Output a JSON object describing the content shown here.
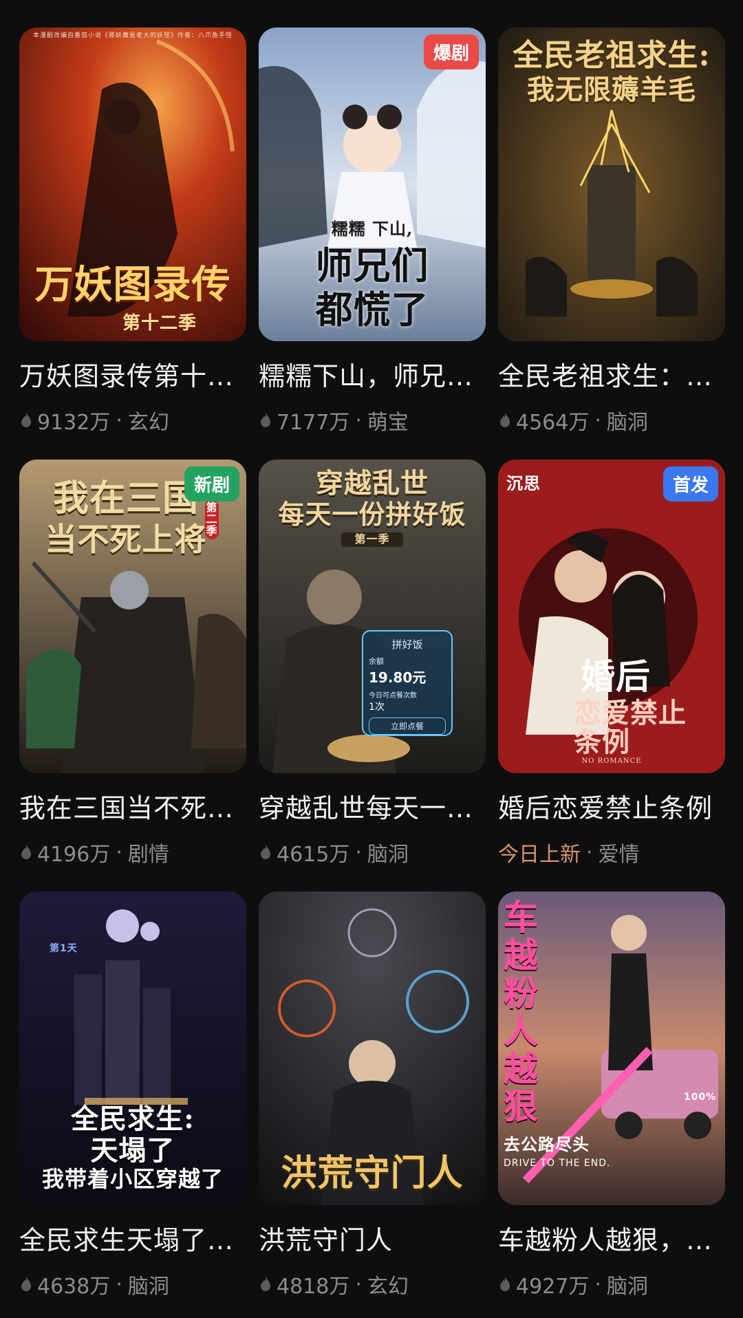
{
  "colors": {
    "background": "#0e0e0f",
    "badge_red": "#e94a47",
    "badge_green": "#23a35f",
    "badge_blue": "#3a78f0",
    "meta_gray": "#8d8d90",
    "new_today": "#d8936c"
  },
  "cards": [
    {
      "title": "万妖图录传第十…",
      "poster_title": "万妖图录传",
      "poster_sub": "第十二季",
      "poster_top_note": "本漫剧改编自番茄小说《那妖魔是老大的妖怪》作者：八爪鱼手怪",
      "badge": "",
      "views": "9132万",
      "genre": "玄幻",
      "icon": "fire-icon"
    },
    {
      "title": "糯糯下山，师兄…",
      "poster_title": "师兄们",
      "poster_sub": "都慌了",
      "poster_top_note": "糯糯 下山,",
      "badge": "爆剧",
      "views": "7177万",
      "genre": "萌宝",
      "icon": "fire-icon"
    },
    {
      "title": "全民老祖求生：…",
      "poster_title": "全民老祖求生:",
      "poster_sub": "我无限薅羊毛",
      "poster_top_note": "",
      "badge": "",
      "views": "4564万",
      "genre": "脑洞",
      "icon": "fire-icon"
    },
    {
      "title": "我在三国当不死…",
      "poster_title": "我在三国",
      "poster_sub": "当不死上将",
      "poster_top_note": "第二季",
      "badge": "新剧",
      "views": "4196万",
      "genre": "剧情",
      "icon": "fire-icon"
    },
    {
      "title": "穿越乱世每天一…",
      "poster_title": "穿越乱世",
      "poster_sub": "每天一份拼好饭",
      "poster_top_note": "第一季",
      "panel": {
        "title": "拼好饭",
        "label1": "余额",
        "amount": "19.80元",
        "label2": "今日可点餐次数",
        "count": "1次",
        "button": "立即点餐"
      },
      "badge": "",
      "views": "4615万",
      "genre": "脑洞",
      "icon": "fire-icon"
    },
    {
      "title": "婚后恋爱禁止条例",
      "poster_title": "婚后",
      "poster_sub": "恋爱禁止条例",
      "poster_top_note": "沉思",
      "poster_bottom_note": "NO ROMANCE",
      "badge": "首发",
      "views": "",
      "status_text": "今日上新",
      "genre": "爱情",
      "icon": ""
    },
    {
      "title": "全民求生天塌了…",
      "poster_title": "全民求生:",
      "poster_sub": "天塌了",
      "poster_sub2": "我带着小区穿越了",
      "poster_top_note": "第1天",
      "badge": "",
      "views": "4638万",
      "genre": "脑洞",
      "icon": "fire-icon"
    },
    {
      "title": "洪荒守门人",
      "poster_title": "洪荒守门人",
      "poster_sub": "",
      "poster_top_note": "",
      "badge": "",
      "views": "4818万",
      "genre": "玄幻",
      "icon": "fire-icon"
    },
    {
      "title": "车越粉人越狠，…",
      "poster_title": "车越粉人越狠",
      "poster_sub": "去公路尽头",
      "poster_sub2": "DRIVE TO THE END.",
      "poster_side_note": "100%",
      "poster_top_note": "",
      "badge": "",
      "views": "4927万",
      "genre": "脑洞",
      "icon": "fire-icon"
    }
  ]
}
